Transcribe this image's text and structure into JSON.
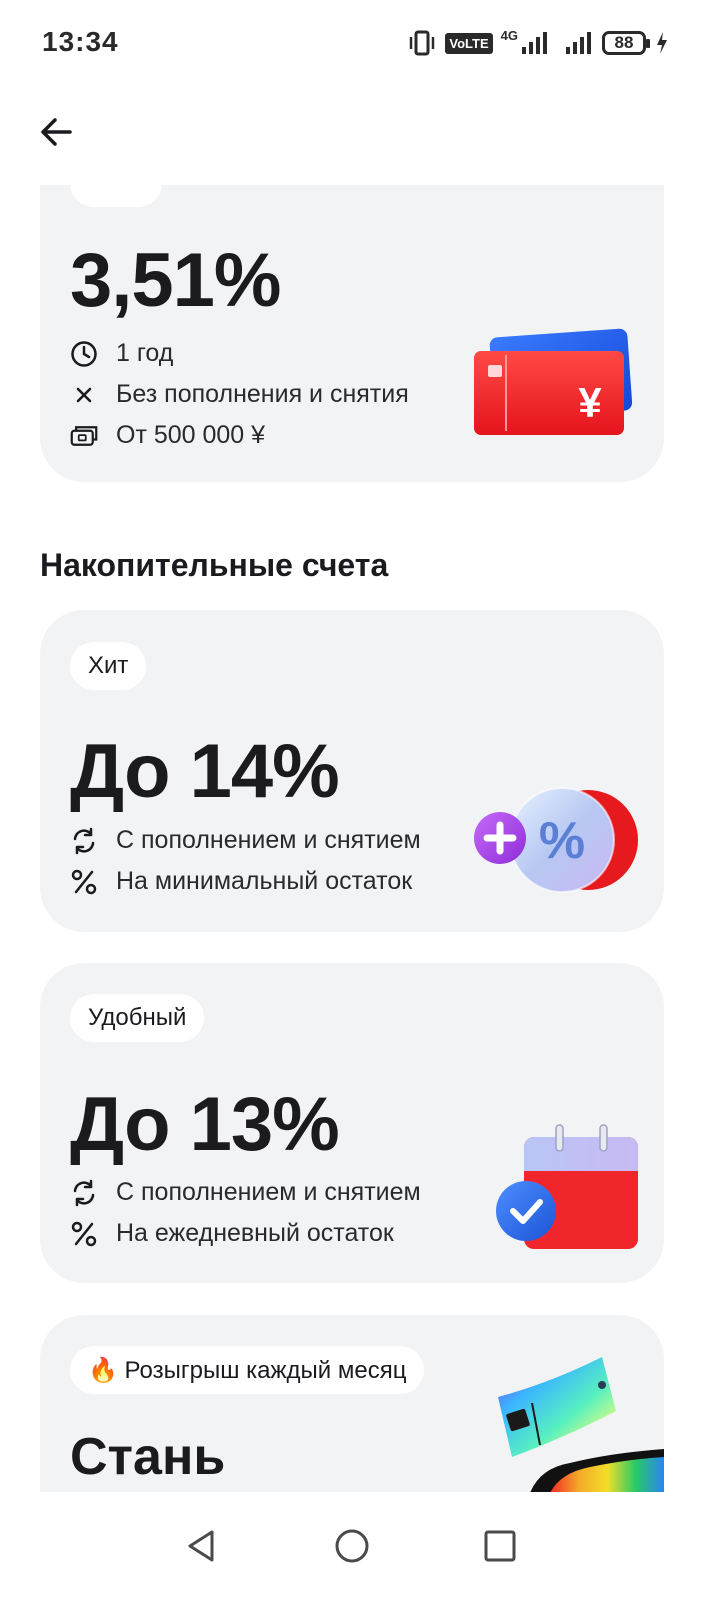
{
  "status_bar": {
    "time": "13:34",
    "volte": "VoLTE",
    "network": "4G",
    "battery": "88"
  },
  "top_card": {
    "rate": "3,51%",
    "features": [
      {
        "icon": "clock-icon",
        "text": "1 год"
      },
      {
        "icon": "close-icon",
        "text": "Без пополнения и снятия"
      },
      {
        "icon": "wallet-icon",
        "text": "От 500 000 ¥"
      }
    ],
    "illustration": "yuan-card-icon"
  },
  "section": {
    "title": "Накопительные счета"
  },
  "accounts": [
    {
      "badge": "Хит",
      "rate": "До 14%",
      "features": [
        {
          "icon": "refresh-icon",
          "text": "С пополнением и снятием"
        },
        {
          "icon": "percent-icon",
          "text": "На минимальный остаток"
        }
      ],
      "illustration": "percent-coin-icon"
    },
    {
      "badge": "Удобный",
      "rate": "До 13%",
      "features": [
        {
          "icon": "refresh-icon",
          "text": "С пополнением и снятием"
        },
        {
          "icon": "percent-icon",
          "text": "На ежедневный остаток"
        }
      ],
      "illustration": "calendar-check-icon"
    },
    {
      "badge": "🔥 Розыгрыш каждый месяц",
      "rate": "Стань",
      "illustration": "holographic-card-icon"
    }
  ],
  "colors": {
    "card_bg": "#f2f3f5",
    "accent_red": "#f0282d",
    "text_primary": "#1b1b1f"
  }
}
